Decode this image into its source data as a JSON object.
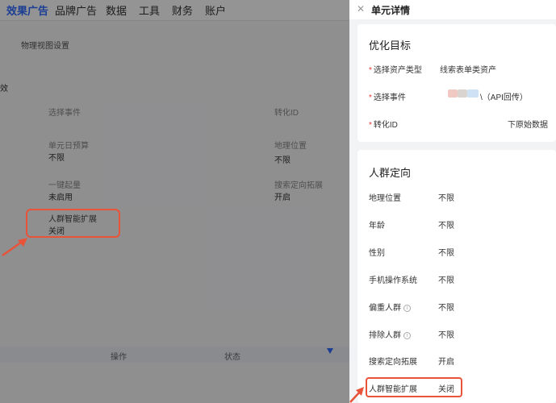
{
  "topnav": {
    "items": [
      "效果广告",
      "品牌广告",
      "数据",
      "工具",
      "财务",
      "账户"
    ],
    "active_index": 0
  },
  "background": {
    "link_text": "物理视图设置",
    "side_label": "效",
    "fields": [
      {
        "label": "选择事件",
        "value": ""
      },
      {
        "label": "转化ID",
        "value": ""
      },
      {
        "label": "单元日预算",
        "value": "不限"
      },
      {
        "label": "地理位置",
        "value": "不限"
      },
      {
        "label": "一键起量",
        "value": "未启用"
      },
      {
        "label": "搜索定向拓展",
        "value": "开启"
      },
      {
        "label": "人群智能扩展",
        "value": "关闭"
      }
    ],
    "table_headers": [
      "操作",
      "状态"
    ]
  },
  "drawer": {
    "title": "单元详情",
    "close_icon": "close-icon",
    "optimization": {
      "title": "优化目标",
      "rows": [
        {
          "label": "选择资产类型",
          "value": "线索表单类资产"
        },
        {
          "label": "选择事件",
          "value": "\\（API回传）"
        },
        {
          "label": "转化ID",
          "value": "下原始数据"
        }
      ]
    },
    "audience": {
      "title": "人群定向",
      "rows": [
        {
          "label": "地理位置",
          "value": "不限",
          "info": false
        },
        {
          "label": "年龄",
          "value": "不限",
          "info": false
        },
        {
          "label": "性别",
          "value": "不限",
          "info": false
        },
        {
          "label": "手机操作系统",
          "value": "不限",
          "info": false
        },
        {
          "label": "偏重人群",
          "value": "不限",
          "info": true
        },
        {
          "label": "排除人群",
          "value": "不限",
          "info": true
        },
        {
          "label": "搜索定向拓展",
          "value": "开启",
          "info": false
        },
        {
          "label": "人群智能扩展",
          "value": "关闭",
          "info": false
        }
      ]
    }
  },
  "colors": {
    "accent": "#2f6bff",
    "highlight": "#e8533a",
    "required": "#e53935"
  }
}
